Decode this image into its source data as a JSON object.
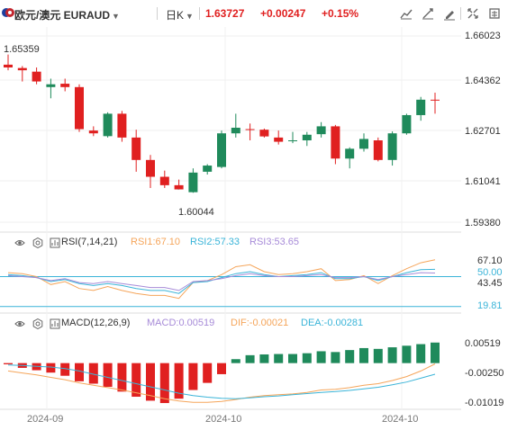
{
  "toolbar": {
    "pair": "欧元/澳元 EURAUD",
    "period": "日K",
    "price": "1.63727",
    "change": "+0.00247",
    "change_pct": "+0.15%",
    "icons": [
      "chart-type-icon",
      "indicator-icon",
      "draw-icon",
      "settings-icon",
      "fullscreen-icon",
      "screenshot-icon"
    ],
    "colors": {
      "up": "#e02020",
      "down": "#1f8a5b"
    }
  },
  "main_chart": {
    "y_ticks": [
      "1.66023",
      "1.64362",
      "1.62701",
      "1.61041",
      "1.59380"
    ],
    "high_annotation": "1.65359",
    "low_annotation": "1.60044"
  },
  "rsi": {
    "label": "RSI(7,14,21)",
    "rsi1": "RSI1:67.10",
    "rsi2": "RSI2:57.33",
    "rsi3": "RSI3:53.65",
    "y_ticks": [
      "67.10",
      "50.00",
      "43.45",
      "19.81"
    ]
  },
  "macd": {
    "label": "MACD(12,26,9)",
    "macd": "MACD:0.00519",
    "dif": "DIF:-0.00021",
    "dea": "DEA:-0.00281",
    "y_ticks": [
      "0.00519",
      "-0.00250",
      "-0.01019"
    ]
  },
  "x_axis": [
    "2024-09",
    "2024-10",
    "2024-10"
  ],
  "chart_data": {
    "type": "candlestick",
    "y_range": [
      1.5938,
      1.66023
    ],
    "candles": [
      {
        "o": 1.65,
        "h": 1.6536,
        "l": 1.648,
        "c": 1.649
      },
      {
        "o": 1.6488,
        "h": 1.6495,
        "l": 1.644,
        "c": 1.648
      },
      {
        "o": 1.6475,
        "h": 1.649,
        "l": 1.643,
        "c": 1.644
      },
      {
        "o": 1.642,
        "h": 1.645,
        "l": 1.638,
        "c": 1.643
      },
      {
        "o": 1.6432,
        "h": 1.645,
        "l": 1.6405,
        "c": 1.642
      },
      {
        "o": 1.642,
        "h": 1.643,
        "l": 1.626,
        "c": 1.627
      },
      {
        "o": 1.6265,
        "h": 1.628,
        "l": 1.6245,
        "c": 1.6255
      },
      {
        "o": 1.6245,
        "h": 1.633,
        "l": 1.624,
        "c": 1.6325
      },
      {
        "o": 1.6325,
        "h": 1.6335,
        "l": 1.6225,
        "c": 1.624
      },
      {
        "o": 1.624,
        "h": 1.6268,
        "l": 1.6118,
        "c": 1.616
      },
      {
        "o": 1.616,
        "h": 1.6178,
        "l": 1.606,
        "c": 1.61
      },
      {
        "o": 1.61,
        "h": 1.6122,
        "l": 1.606,
        "c": 1.607
      },
      {
        "o": 1.607,
        "h": 1.609,
        "l": 1.6055,
        "c": 1.6055
      },
      {
        "o": 1.6045,
        "h": 1.613,
        "l": 1.6043,
        "c": 1.6115
      },
      {
        "o": 1.6118,
        "h": 1.6145,
        "l": 1.6108,
        "c": 1.614
      },
      {
        "o": 1.6135,
        "h": 1.6265,
        "l": 1.613,
        "c": 1.6255
      },
      {
        "o": 1.6255,
        "h": 1.6325,
        "l": 1.624,
        "c": 1.6275
      },
      {
        "o": 1.627,
        "h": 1.629,
        "l": 1.623,
        "c": 1.6268
      },
      {
        "o": 1.6268,
        "h": 1.6272,
        "l": 1.624,
        "c": 1.6244
      },
      {
        "o": 1.624,
        "h": 1.6265,
        "l": 1.6215,
        "c": 1.6225
      },
      {
        "o": 1.6228,
        "h": 1.626,
        "l": 1.622,
        "c": 1.623
      },
      {
        "o": 1.623,
        "h": 1.626,
        "l": 1.621,
        "c": 1.625
      },
      {
        "o": 1.6252,
        "h": 1.6295,
        "l": 1.624,
        "c": 1.628
      },
      {
        "o": 1.628,
        "h": 1.6285,
        "l": 1.6145,
        "c": 1.6165
      },
      {
        "o": 1.6165,
        "h": 1.6205,
        "l": 1.613,
        "c": 1.62
      },
      {
        "o": 1.62,
        "h": 1.6255,
        "l": 1.619,
        "c": 1.6235
      },
      {
        "o": 1.623,
        "h": 1.624,
        "l": 1.6155,
        "c": 1.616
      },
      {
        "o": 1.616,
        "h": 1.6262,
        "l": 1.614,
        "c": 1.6255
      },
      {
        "o": 1.6255,
        "h": 1.6325,
        "l": 1.625,
        "c": 1.632
      },
      {
        "o": 1.632,
        "h": 1.6385,
        "l": 1.63,
        "c": 1.6375
      },
      {
        "o": 1.6375,
        "h": 1.64,
        "l": 1.6325,
        "c": 1.6373
      }
    ],
    "rsi_series": [
      {
        "name": "RSI1",
        "color": "#f5a55a",
        "values": [
          54,
          53,
          50,
          42,
          45,
          38,
          36,
          40,
          36,
          33,
          31,
          31,
          28,
          44,
          46,
          52,
          60,
          62,
          55,
          52,
          53,
          55,
          58,
          46,
          47,
          51,
          43,
          51,
          58,
          64,
          67.1
        ]
      },
      {
        "name": "RSI2",
        "color": "#3ab4d8",
        "values": [
          52,
          51,
          49,
          45,
          47,
          43,
          41,
          43,
          41,
          38,
          36,
          36,
          33,
          44,
          45,
          49,
          53,
          55,
          52,
          50,
          51,
          52,
          54,
          48,
          48,
          50,
          46,
          50,
          54,
          57,
          57.33
        ]
      },
      {
        "name": "RSI3",
        "color": "#a78bd8",
        "values": [
          51,
          50,
          49,
          46,
          48,
          44,
          43,
          45,
          43,
          41,
          39,
          39,
          36,
          45,
          46,
          48,
          51,
          53,
          51,
          50,
          50,
          51,
          52,
          49,
          49,
          50,
          47,
          50,
          52,
          54,
          53.65
        ]
      }
    ],
    "macd_hist": [
      -0.0003,
      -0.0012,
      -0.0018,
      -0.0024,
      -0.0032,
      -0.0046,
      -0.0052,
      -0.006,
      -0.0072,
      -0.0085,
      -0.0095,
      -0.0101,
      -0.009,
      -0.0068,
      -0.005,
      -0.0028,
      0.001,
      0.002,
      0.0022,
      0.0023,
      0.0023,
      0.0025,
      0.003,
      0.0028,
      0.0033,
      0.0038,
      0.0036,
      0.004,
      0.0044,
      0.0048,
      0.0052
    ],
    "dif": [
      -0.002,
      -0.0025,
      -0.003,
      -0.0036,
      -0.0042,
      -0.005,
      -0.0056,
      -0.0062,
      -0.0068,
      -0.0075,
      -0.0082,
      -0.009,
      -0.0096,
      -0.0099,
      -0.0099,
      -0.0097,
      -0.0092,
      -0.0086,
      -0.0082,
      -0.008,
      -0.0078,
      -0.0074,
      -0.0068,
      -0.0066,
      -0.0062,
      -0.0056,
      -0.0052,
      -0.0044,
      -0.0034,
      -0.002,
      -0.0002
    ],
    "dea": [
      -0.0005,
      -0.0006,
      -0.0008,
      -0.001,
      -0.0014,
      -0.002,
      -0.0028,
      -0.0036,
      -0.0044,
      -0.0052,
      -0.006,
      -0.0068,
      -0.0076,
      -0.0082,
      -0.0086,
      -0.0089,
      -0.009,
      -0.0088,
      -0.0085,
      -0.0083,
      -0.008,
      -0.0077,
      -0.0074,
      -0.0072,
      -0.0069,
      -0.0065,
      -0.0061,
      -0.0055,
      -0.0048,
      -0.0038,
      -0.0028
    ]
  }
}
